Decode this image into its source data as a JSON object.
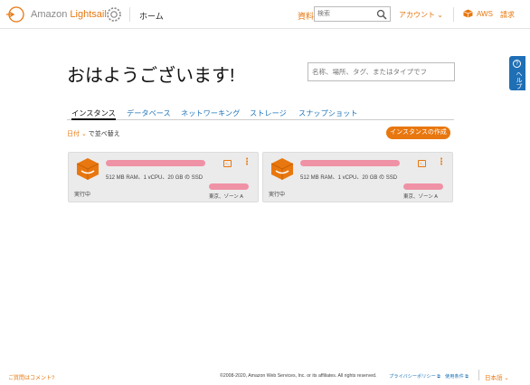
{
  "header": {
    "logo_prefix": "Amazon ",
    "logo_brand": "Lightsail",
    "home": "ホーム",
    "resources": "資料",
    "search_placeholder": "検索",
    "account": "アカウント",
    "account_caret": "⌄",
    "aws": "AWS",
    "billing": "請求"
  },
  "side_help": {
    "label": "ヘルプ",
    "icon_glyph": "?"
  },
  "main": {
    "greeting": "おはようございます!",
    "search_placeholder": "名称、場所、タグ、またはタイプでフ",
    "tabs": [
      {
        "label": "インスタンス",
        "active": true
      },
      {
        "label": "データベース",
        "active": false
      },
      {
        "label": "ネットワーキング",
        "active": false
      },
      {
        "label": "ストレージ",
        "active": false
      },
      {
        "label": "スナップショット",
        "active": false
      }
    ],
    "sort_value": "日付",
    "sort_caret": "⌄",
    "sort_suffix": " で並べ替え",
    "create_button": "インスタンスの作成"
  },
  "instances": [
    {
      "spec": "512 MB RAM、1 vCPU、20 GB の SSD",
      "status": "実行中",
      "zone": "東京、ゾーン A",
      "terminal_glyph": ">_",
      "more_glyph": "⋮"
    },
    {
      "spec": "512 MB RAM、1 vCPU、20 GB の SSD",
      "status": "実行中",
      "zone": "東京、ゾーン A",
      "terminal_glyph": ">_",
      "more_glyph": "⋮"
    }
  ],
  "footer": {
    "feedback": "ご質問はコメント?",
    "copyright": "©2008-2020, Amazon Web Services, Inc. or its affiliates. All rights reserved.",
    "privacy": "プライバシーポリシー ⧉",
    "terms": "使用条件 ⧉",
    "language": "日本語",
    "language_caret": "⌄"
  },
  "colors": {
    "accent": "#e8770f",
    "link": "#1f74b9",
    "help_tab": "#1f6fb5",
    "card_bg": "#ebebeb"
  }
}
